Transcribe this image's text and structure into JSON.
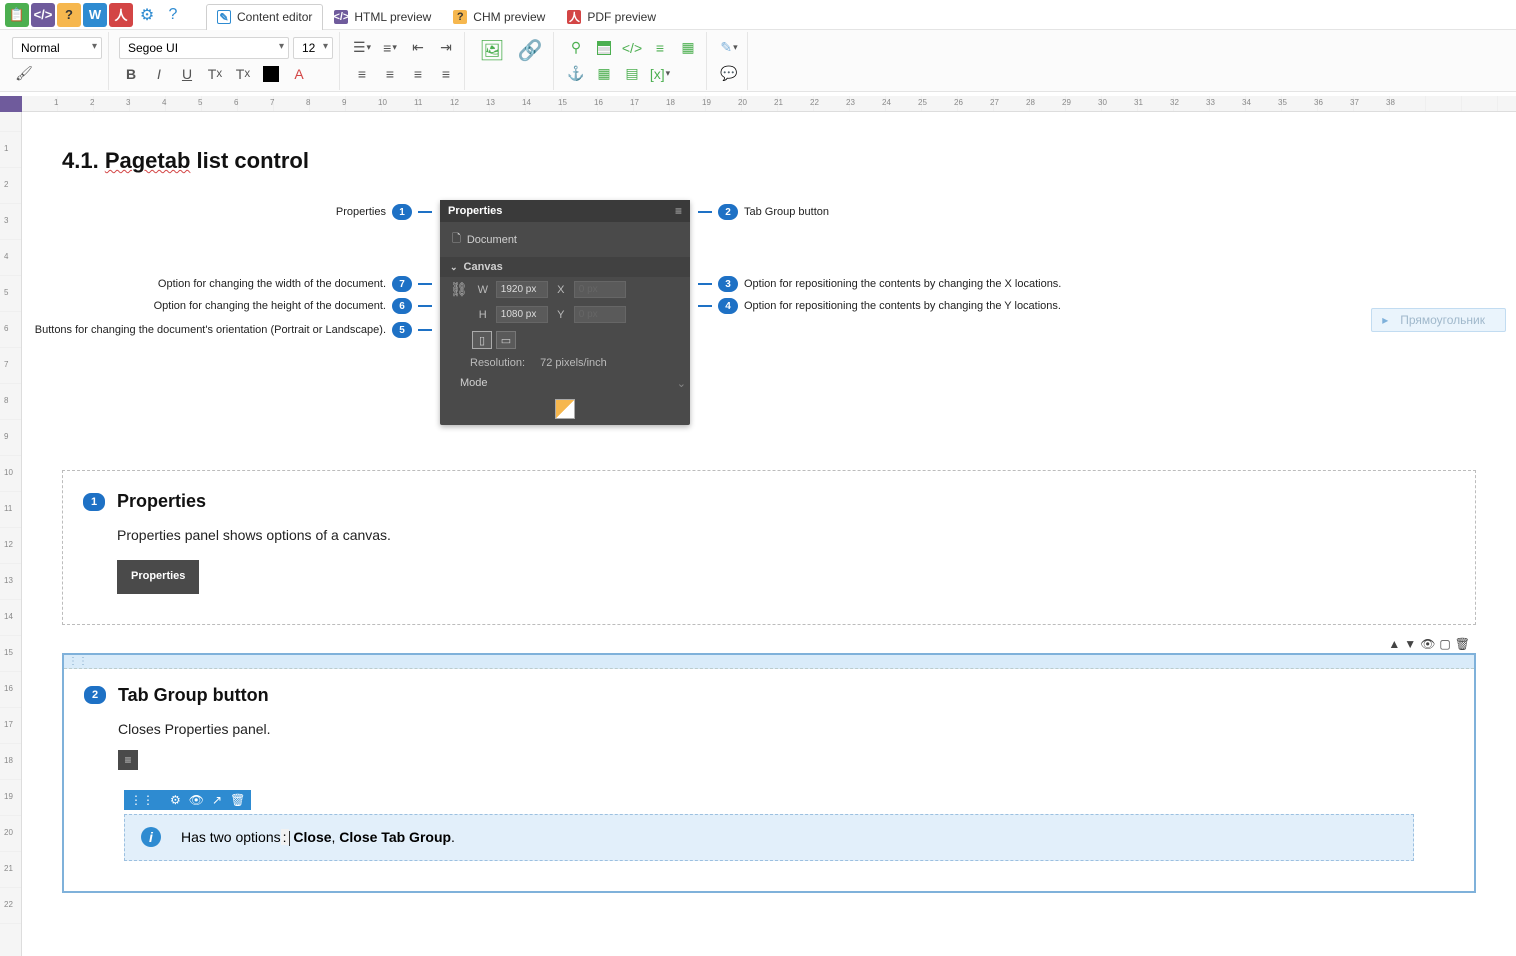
{
  "quickbar": {
    "buttons": [
      "copy",
      "code",
      "help",
      "word",
      "pdf",
      "settings",
      "about"
    ]
  },
  "tabs": {
    "content_editor": "Content editor",
    "html_preview": "HTML preview",
    "chm_preview": "CHM preview",
    "pdf_preview": "PDF preview"
  },
  "format": {
    "style": "Normal",
    "font": "Segoe UI",
    "size": "12"
  },
  "doc": {
    "title_prefix": "4.1. ",
    "title_underlined": "Pagetab",
    "title_suffix": " list control"
  },
  "panel": {
    "header": "Properties",
    "doc_label": "Document",
    "section": "Canvas",
    "w_label": "W",
    "h_label": "H",
    "x_label": "X",
    "y_label": "Y",
    "w_val": "1920 px",
    "h_val": "1080 px",
    "x_val": "0 px",
    "y_val": "0 px",
    "res_label": "Resolution:",
    "res_val": "72 pixels/inch",
    "mode_label": "Mode"
  },
  "callouts": {
    "c1": "Properties",
    "c2": "Tab Group button",
    "c3": "Option for repositioning the contents by changing the X locations.",
    "c4": "Option for repositioning the contents by changing the Y locations.",
    "c5": "Buttons for changing the document's orientation (Portrait or Landscape).",
    "c6": "Option for changing the height of the document.",
    "c7": "Option for changing the width of the document."
  },
  "ghost": "Прямоугольник",
  "sec1": {
    "title": "Properties",
    "body": "Properties panel shows options of a canvas.",
    "chip": "Properties"
  },
  "sec2": {
    "title": "Tab Group button",
    "body": "Closes Properties panel.",
    "note_prefix": "Has two options",
    "note_colon_char": ":",
    "note_opt1": "Close",
    "note_sep": ", ",
    "note_opt2": "Close Tab Group",
    "note_period": "."
  }
}
